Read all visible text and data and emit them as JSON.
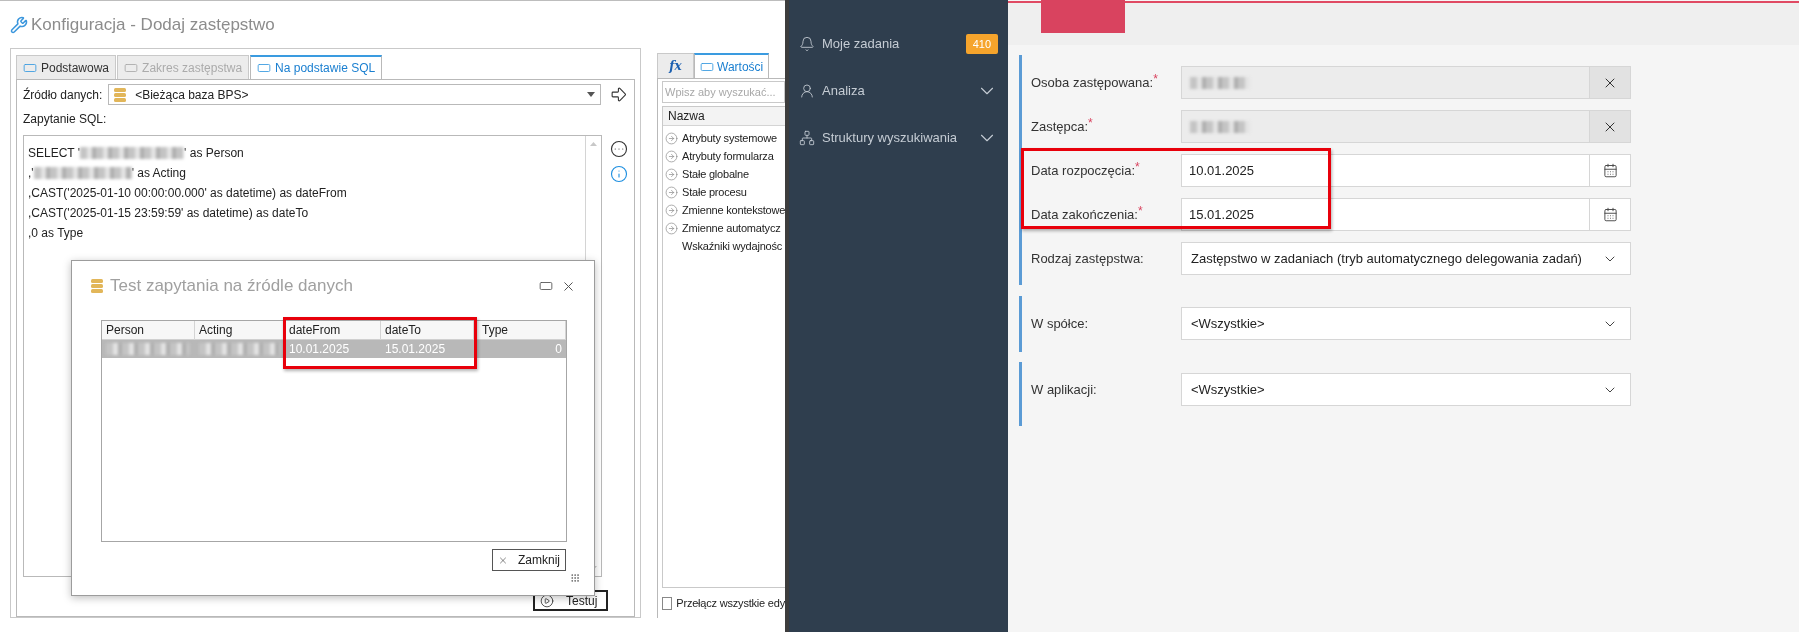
{
  "window": {
    "title": "Konfiguracja - Dodaj zastępstwo"
  },
  "tabs": [
    {
      "label": "Podstawowa",
      "selected": false,
      "disabled": false
    },
    {
      "label": "Zakres zastępstwa",
      "selected": false,
      "disabled": true
    },
    {
      "label": "Na podstawie SQL",
      "selected": true,
      "disabled": false
    }
  ],
  "data_source": {
    "label": "Źródło danych:",
    "value": "<Bieżąca baza BPS>"
  },
  "sql": {
    "label": "Zapytanie SQL:",
    "lines": [
      {
        "before": "SELECT '",
        "redacted": true,
        "after": "' as Person"
      },
      {
        "before": ",'",
        "redacted": true,
        "after": "' as Acting"
      },
      {
        "before": ",CAST('2025-01-10 00:00:00.000' as datetime) as dateFrom",
        "redacted": false
      },
      {
        "before": ",CAST('2025-01-15 23:59:59' as datetime) as dateTo",
        "redacted": false
      },
      {
        "before": ",0 as Type",
        "redacted": false
      }
    ]
  },
  "test_button": "Testuj",
  "side_tabs": [
    {
      "label": "fx",
      "selected": false
    },
    {
      "label": "Wartości",
      "selected": true
    }
  ],
  "values_panel": {
    "placeholder": "Wpisz aby wyszukać...",
    "column": "Nazwa",
    "items": [
      {
        "label": "Atrybuty systemowe",
        "expandable": true
      },
      {
        "label": "Atrybuty formularza",
        "expandable": true
      },
      {
        "label": "Stałe globalne",
        "expandable": true
      },
      {
        "label": "Stałe procesu",
        "expandable": true
      },
      {
        "label": "Zmienne kontekstowe",
        "expandable": true
      },
      {
        "label": "Zmienne automatycz",
        "expandable": true
      },
      {
        "label": "Wskaźniki wydajnośc",
        "expandable": false
      }
    ]
  },
  "toggle_all": {
    "label": "Przełącz wszystkie edy",
    "checked": false
  },
  "test_dialog": {
    "title": "Test zapytania na źródle danych",
    "columns": [
      "Person",
      "Acting",
      "dateFrom",
      "dateTo",
      "Type"
    ],
    "rows": [
      {
        "selected": true,
        "cells": [
          {
            "redacted": true
          },
          {
            "redacted": true
          },
          {
            "text": "10.01.2025",
            "redacted": false
          },
          {
            "text": "15.01.2025",
            "redacted": false
          },
          {
            "text": "0",
            "redacted": false
          }
        ]
      }
    ],
    "close_button": "Zamknij"
  },
  "sidebar": {
    "items": [
      {
        "label": "Moje zadania",
        "badge": "410",
        "expandable": false
      },
      {
        "label": "Analiza",
        "expandable": true
      },
      {
        "label": "Struktury wyszukiwania",
        "expandable": true
      }
    ]
  },
  "form": {
    "sections": [
      {
        "fields": [
          {
            "label": "Osoba zastępowana:",
            "required_mark": "*",
            "kind": "lookup",
            "redacted": true
          },
          {
            "label": "Zastępca:",
            "required_mark": "*",
            "kind": "lookup",
            "redacted": true
          },
          {
            "label": "Data rozpoczęcia:",
            "required_mark": "*",
            "kind": "date",
            "value": "10.01.2025"
          },
          {
            "label": "Data zakończenia:",
            "required_mark": "*",
            "kind": "date",
            "value": "15.01.2025"
          },
          {
            "label": "Rodzaj zastępstwa:",
            "kind": "select",
            "value": "Zastępstwo w zadaniach (tryb automatycznego delegowania zadań)"
          }
        ]
      },
      {
        "fields": [
          {
            "label": "W spółce:",
            "kind": "select",
            "value": "<Wszystkie>"
          }
        ]
      },
      {
        "fields": [
          {
            "label": "W aplikacji:",
            "kind": "select",
            "value": "<Wszystkie>"
          }
        ]
      }
    ]
  }
}
